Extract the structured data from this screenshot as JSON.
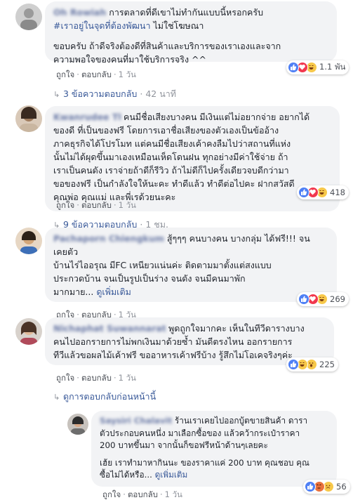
{
  "labels": {
    "like": "ถูกใจ",
    "reply": "ตอบกลับ",
    "dot": "·"
  },
  "comments": [
    {
      "name": "Oh Rowiah",
      "lines": [
        "การตลาดที่ดีเขาไม่ทำกันแบบนี้หรอกครับ",
        "#เราอยู่ในจุดที่ต้องพัฒนา ไม่ใช่โฆษณา",
        "",
        "ขอบครับ ถ้าดีจริงต้องดีที่สินค้าและบริการของเราเองและจาก",
        "ความพอใจของคนที่มาใช้บริการจริง ^^"
      ],
      "hashtag": "#เราอยู่ในจุดที่ต้องพัฒนา",
      "hashtag_tail": " ไม่ใช่โฆษณา",
      "time": "1 วัน",
      "reaction_count": "1.1 พัน",
      "reactions": [
        "like",
        "love",
        "haha"
      ],
      "replies_label": "3 ข้อความตอบกลับ",
      "replies_time": "42 นาที"
    },
    {
      "name": "Kwanrudee Tharawan",
      "lines": [
        "คนมีชื่อเสียงบางคน มีเงินแต่ไม่อยากจ่าย อยากได้",
        "ของดี ที่เป็นของฟรี โดยการเอาชื่อเสียงของตัวเองเป็นข้ออ้าง",
        "ภาคธุรกิจได้โปรโมท แต่คนมีชื่อเสียงเค้าคงลืมไปว่าสถานที่แห่ง",
        "นั้นไม่ได้ผุดขึ้นมาเองเหมือนเห็ดโดนฝน ทุกอย่างมีค่าใช้จ่าย ถ้า",
        "เราเป็นคนดัง เราจ่ายถ้าดีก็รีวิว ถ้าไม่ดีก็ไปครั้งเดียวจบดีกว่ามา",
        "ขอของฟรี เป็นกำลังใจให้นะคะ ทำดีแล้ว ทำดีต่อไปคะ ฝากสวัสดี",
        "คุณพ่อ คุณแม่ และพี่เรด้วยนะคะ"
      ],
      "time": "1 วัน",
      "reaction_count": "418",
      "reactions": [
        "like",
        "love",
        "haha"
      ],
      "replies_label": "9 ข้อความตอบกลับ",
      "replies_time": "1 ชม."
    },
    {
      "name": "Pachaporn Chiengkum",
      "lines": [
        "สู้ๆๆๆ คนบางคน บางกลุ่ม ได้ฟรี!!! จน",
        "เคยตัว",
        "บ้านไร่ไออรุณ มีFC เหนียวแน่นค่ะ ติดตามมาตั้งแต่สงแบบ",
        "ประกวดบ้าน จนเป็นรูปเป็นร่าง จนดัง จนมีคนมาพัก",
        "มากมาย... "
      ],
      "see_more": "ดูเพิ่มเติม",
      "time": "1 วัน",
      "reaction_count": "269",
      "reactions": [
        "like",
        "love",
        "haha"
      ]
    },
    {
      "name": "Nichaphat Suwannarat",
      "lines": [
        "พูดถูกใจมากคะ เห็นในทีวีดารางบาง",
        "คนไปออกรายการไม่พกเงินมาด้วยซ้ำ มันดีตรงไหน ออกรายการ",
        "ทีวีแล้วขอผลไม้เค้าฟรี ขออาหารเค้าฟรีบ้าง รู้สึกไม่โอเคจริงๆค่ะ"
      ],
      "time": "1 วัน",
      "reaction_count": "225",
      "reactions": [
        "like",
        "haha",
        "wow"
      ],
      "previous_replies_label": "ดูการตอบกลับก่อนหน้านี้"
    }
  ],
  "reply": {
    "name": "Saysiri Chalavit",
    "lines": [
      "ร้านเราเคยไปออกบู้ตขายสินค้า ดารา",
      "ตัวประกอบคนหนึ่ง มาเลือกซื้อของ แล้วคว้ากระเป๋าราคา",
      "200 บาทขึ้นมา จากนั้นก็ขอฟรีหน้าด้านๆเลยคะ",
      "",
      "เฮ้ย เราทำมาหากินนะ ของราคาแค่ 200 บาท คุณชอบ คุณ",
      "ซื้อไม่ได้หรือ... "
    ],
    "see_more": "ดูเพิ่มเติม",
    "time": "1 วัน",
    "reaction_count": "56",
    "reactions": [
      "like",
      "angry",
      "sad"
    ]
  },
  "colors": {
    "link": "#385898",
    "bubble": "#f2f3f5",
    "meta": "#90949c",
    "like": "#4f80f5",
    "love": "#f2384e",
    "haha": "#f7c84a"
  }
}
